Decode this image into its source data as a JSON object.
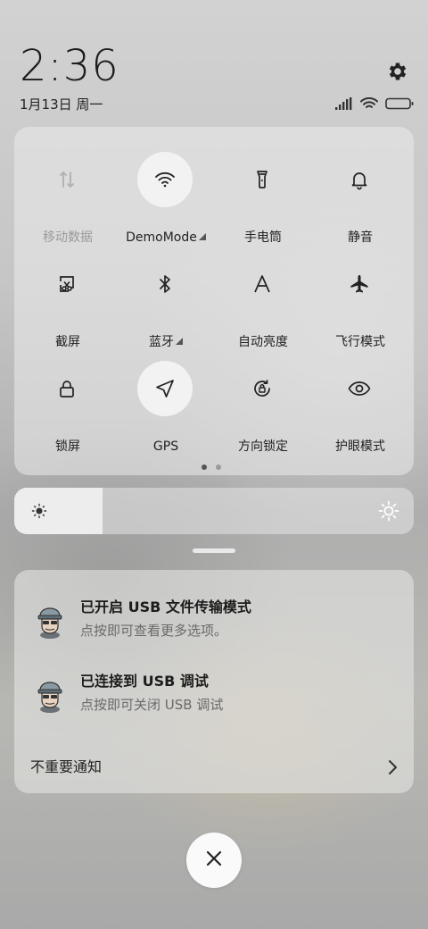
{
  "header": {
    "time": "2:36",
    "date": "1月13日 周一",
    "settings_icon": "gear-icon"
  },
  "status_bar": {
    "icons": [
      "signal-icon",
      "wifi-icon",
      "battery-icon"
    ]
  },
  "quick_settings": {
    "tiles": [
      {
        "label": "移动数据",
        "icon": "mobile-data-icon",
        "active": false,
        "disabled": true,
        "expandable": false
      },
      {
        "label": "DemoMode",
        "icon": "wifi-icon",
        "active": true,
        "disabled": false,
        "expandable": true
      },
      {
        "label": "手电筒",
        "icon": "flashlight-icon",
        "active": false,
        "disabled": false,
        "expandable": false
      },
      {
        "label": "静音",
        "icon": "bell-icon",
        "active": false,
        "disabled": false,
        "expandable": false
      },
      {
        "label": "截屏",
        "icon": "screenshot-icon",
        "active": false,
        "disabled": false,
        "expandable": false
      },
      {
        "label": "蓝牙",
        "icon": "bluetooth-icon",
        "active": false,
        "disabled": false,
        "expandable": true
      },
      {
        "label": "自动亮度",
        "icon": "auto-brightness-icon",
        "active": false,
        "disabled": false,
        "expandable": false
      },
      {
        "label": "飞行模式",
        "icon": "airplane-icon",
        "active": false,
        "disabled": false,
        "expandable": false
      },
      {
        "label": "锁屏",
        "icon": "lock-icon",
        "active": false,
        "disabled": false,
        "expandable": false
      },
      {
        "label": "GPS",
        "icon": "location-arrow-icon",
        "active": true,
        "disabled": false,
        "expandable": false
      },
      {
        "label": "方向锁定",
        "icon": "rotation-lock-icon",
        "active": false,
        "disabled": false,
        "expandable": false
      },
      {
        "label": "护眼模式",
        "icon": "eye-icon",
        "active": false,
        "disabled": false,
        "expandable": false
      }
    ],
    "pages": 2,
    "current_page": 1
  },
  "brightness": {
    "level_percent": 22
  },
  "notifications": [
    {
      "title": "已开启 USB 文件传输模式",
      "subtitle": "点按即可查看更多选项。",
      "icon": "android-debug-avatar-icon"
    },
    {
      "title": "已连接到 USB 调试",
      "subtitle": "点按即可关闭 USB 调试",
      "icon": "android-debug-avatar-icon"
    }
  ],
  "unimportant": {
    "label": "不重要通知"
  },
  "close_icon": "close-icon",
  "colors": {
    "tile_active_bg": "#f2f2f2",
    "text_primary": "#222222",
    "text_secondary": "#6a6a6a",
    "text_disabled": "#9a9a9a"
  }
}
